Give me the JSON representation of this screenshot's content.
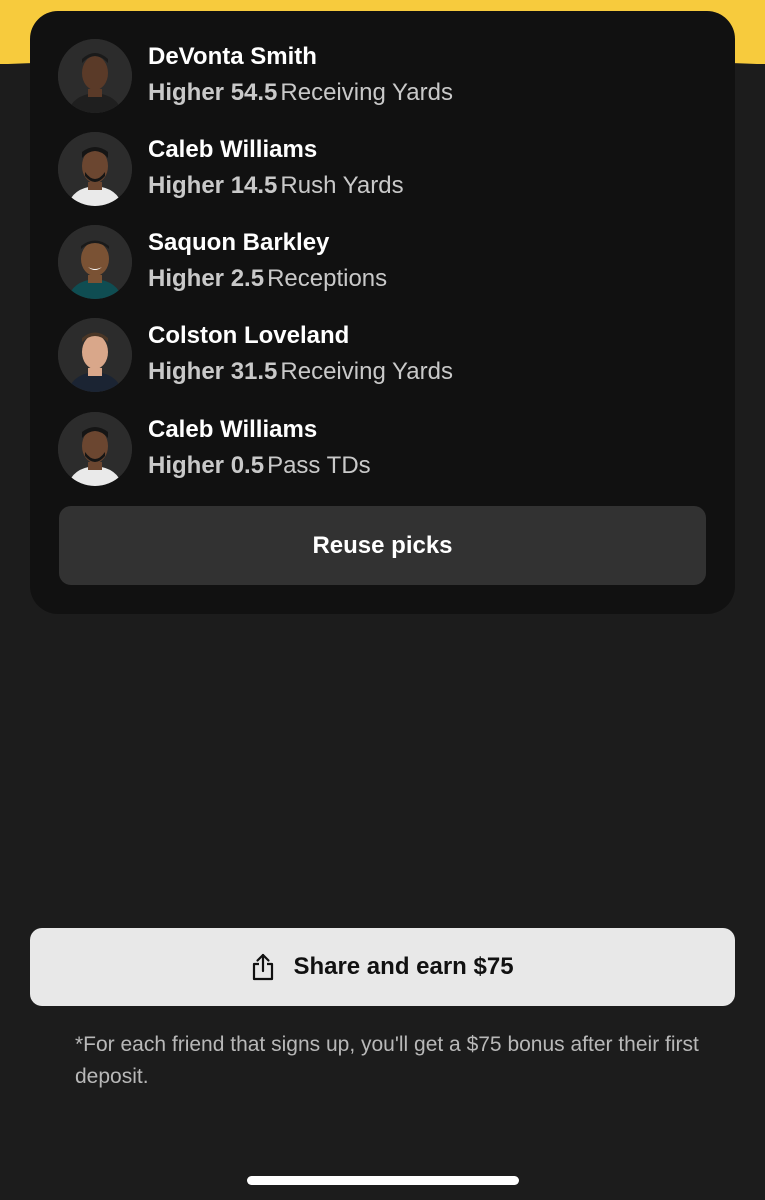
{
  "picks": [
    {
      "name": "DeVonta Smith",
      "direction": "Higher",
      "line": "54.5",
      "stat": "Receiving Yards",
      "avatar_icon": "player-headshot-icon"
    },
    {
      "name": "Caleb Williams",
      "direction": "Higher",
      "line": "14.5",
      "stat": "Rush Yards",
      "avatar_icon": "player-headshot-icon"
    },
    {
      "name": "Saquon Barkley",
      "direction": "Higher",
      "line": "2.5",
      "stat": "Receptions",
      "avatar_icon": "player-headshot-icon"
    },
    {
      "name": "Colston Loveland",
      "direction": "Higher",
      "line": "31.5",
      "stat": "Receiving Yards",
      "avatar_icon": "player-headshot-icon"
    },
    {
      "name": "Caleb Williams",
      "direction": "Higher",
      "line": "0.5",
      "stat": "Pass TDs",
      "avatar_icon": "player-headshot-icon"
    }
  ],
  "reuse_button": {
    "label": "Reuse picks"
  },
  "share_button": {
    "label": "Share and earn $75",
    "icon": "share-icon"
  },
  "disclaimer": "*For each friend that signs up, you'll get a $75 bonus after their first deposit.",
  "colors": {
    "accent": "#f7cb3d",
    "background": "#1c1c1c",
    "card": "#111111",
    "reuse_button": "#323232",
    "share_button": "#e8e8e8"
  }
}
